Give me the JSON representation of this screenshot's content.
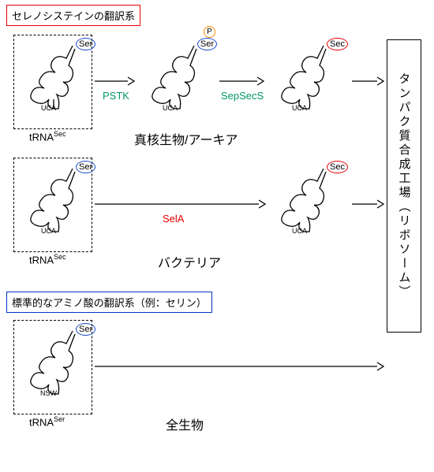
{
  "titles": {
    "selenocysteine": "セレノシステインの翻訳系",
    "standard": "標準的なアミノ酸の翻訳系（例：セリン）"
  },
  "pathways": {
    "eukaryote": "真核生物/アーキア",
    "bacteria": "バクテリア",
    "all": "全生物"
  },
  "enzymes": {
    "pstk": "PSTK",
    "sepsecs": "SepSecS",
    "sela": "SelA"
  },
  "amino_acids": {
    "ser": "Ser",
    "sec": "Sec",
    "p": "P"
  },
  "anticodons": {
    "uca": "UCA",
    "nsw": "NSW"
  },
  "trna_labels": {
    "sec_base": "tRNA",
    "sec_sup": "Sec",
    "ser_base": "tRNA",
    "ser_sup": "Ser"
  },
  "ribosome": "タンパク質合成工場（リボソーム）"
}
